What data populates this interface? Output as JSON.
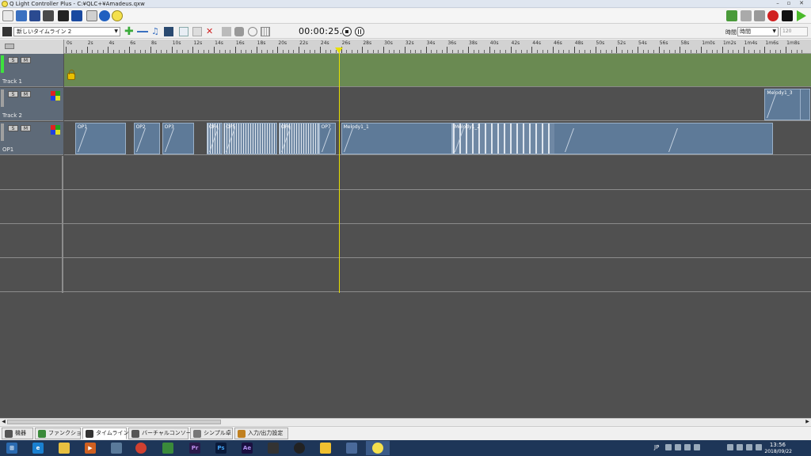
{
  "window": {
    "title": "Q Light Controller Plus - C:¥QLC+¥Amadeus.qxw",
    "min": "–",
    "max": "▫",
    "close": "✕"
  },
  "timeline_toolbar": {
    "timeline_name": "新しいタイムライン 2",
    "timecode": "00:00:25.8",
    "timebase_label": "時間",
    "timebase_value": "時間",
    "bpm_value": "120"
  },
  "ruler": {
    "labels": [
      "0s",
      "2s",
      "4s",
      "6s",
      "8s",
      "10s",
      "12s",
      "14s",
      "16s",
      "18s",
      "20s",
      "22s",
      "24s",
      "26s",
      "28s",
      "30s",
      "32s",
      "34s",
      "36s",
      "38s",
      "40s",
      "42s",
      "44s",
      "46s",
      "48s",
      "50s",
      "52s",
      "54s",
      "56s",
      "58s",
      "1m0s",
      "1m2s",
      "1m4s",
      "1m6s",
      "1m8s"
    ]
  },
  "tracks": [
    {
      "name": "Track 1",
      "solo": "S",
      "mute": "M",
      "active": true
    },
    {
      "name": "Track 2",
      "solo": "S",
      "mute": "M",
      "active": false
    },
    {
      "name": "OP1",
      "solo": "S",
      "mute": "M",
      "active": false
    }
  ],
  "clips_track2": [
    {
      "label": "Melody1_3",
      "start": 66.0,
      "end": 70.4
    }
  ],
  "clips_track3": [
    {
      "label": "OP1",
      "start": 0.9,
      "end": 5.7
    },
    {
      "label": "OP2",
      "start": 6.4,
      "end": 8.9
    },
    {
      "label": "OP3",
      "start": 9.1,
      "end": 12.1
    },
    {
      "label": "OP4",
      "start": 13.3,
      "end": 14.8
    },
    {
      "label": "OP5",
      "start": 14.9,
      "end": 20.0
    },
    {
      "label": "OP6",
      "start": 20.1,
      "end": 23.9
    },
    {
      "label": "OP7",
      "start": 23.9,
      "end": 25.5
    },
    {
      "label": "Melody1_1",
      "start": 26.0,
      "end": 36.5
    },
    {
      "label": "Melody1_2",
      "start": 36.5,
      "end": 66.8
    }
  ],
  "cursor_seconds": 25.8,
  "tabs": [
    {
      "label": "機器",
      "active": false,
      "color": "#555555"
    },
    {
      "label": "ファンクション",
      "active": false,
      "color": "#3a8a3a"
    },
    {
      "label": "タイムライン",
      "active": true,
      "color": "#333333"
    },
    {
      "label": "バーチャルコンソール",
      "active": false,
      "color": "#555555"
    },
    {
      "label": "シンプル卓",
      "active": false,
      "color": "#777777"
    },
    {
      "label": "入力/出力設定",
      "active": false,
      "color": "#c08020"
    }
  ],
  "taskbar": {
    "lang": "JP",
    "time": "13:56",
    "date": "2018/09/22"
  },
  "colors": {
    "track1_lane": "#6a8a52",
    "clip": "#5e7a98",
    "cursor": "#e8e000"
  }
}
